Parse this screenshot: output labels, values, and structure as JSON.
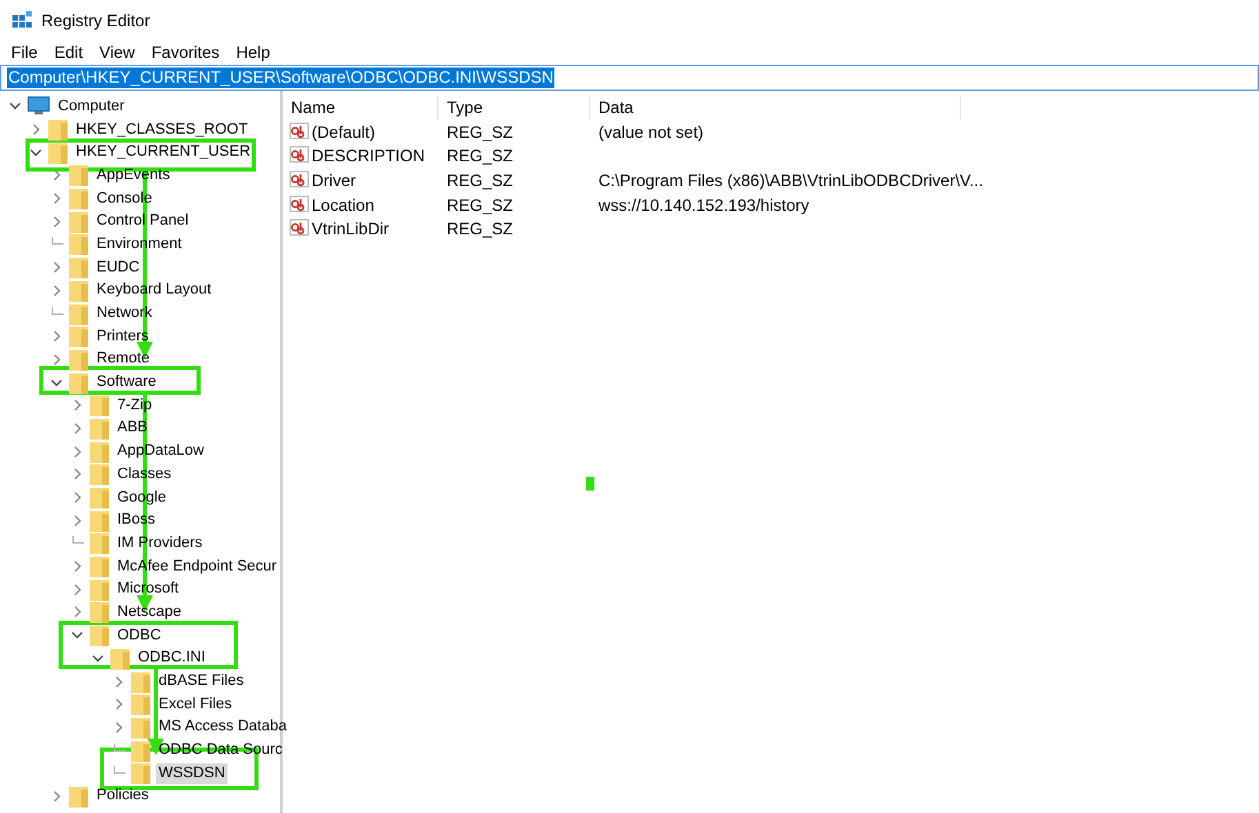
{
  "window": {
    "title": "Registry Editor"
  },
  "menu": [
    "File",
    "Edit",
    "View",
    "Favorites",
    "Help"
  ],
  "address_bar": {
    "value": "Computer\\HKEY_CURRENT_USER\\Software\\ODBC\\ODBC.INI\\WSSDSN",
    "highlighted": true
  },
  "tree": [
    {
      "label": "Computer",
      "kind": "computer",
      "expanded": true,
      "selected": false,
      "has_children": true,
      "children": [
        {
          "label": "HKEY_CLASSES_ROOT",
          "kind": "folder",
          "expanded": false,
          "selected": false,
          "has_children": true
        },
        {
          "label": "HKEY_CURRENT_USER",
          "kind": "folder",
          "expanded": true,
          "selected": false,
          "has_children": true,
          "children": [
            {
              "label": "AppEvents",
              "kind": "folder",
              "expanded": false,
              "selected": false,
              "has_children": true
            },
            {
              "label": "Console",
              "kind": "folder",
              "expanded": false,
              "selected": false,
              "has_children": true
            },
            {
              "label": "Control Panel",
              "kind": "folder",
              "expanded": false,
              "selected": false,
              "has_children": true
            },
            {
              "label": "Environment",
              "kind": "folder",
              "expanded": false,
              "selected": false,
              "has_children": false
            },
            {
              "label": "EUDC",
              "kind": "folder",
              "expanded": false,
              "selected": false,
              "has_children": true
            },
            {
              "label": "Keyboard Layout",
              "kind": "folder",
              "expanded": false,
              "selected": false,
              "has_children": true
            },
            {
              "label": "Network",
              "kind": "folder",
              "expanded": false,
              "selected": false,
              "has_children": false
            },
            {
              "label": "Printers",
              "kind": "folder",
              "expanded": false,
              "selected": false,
              "has_children": true
            },
            {
              "label": "Remote",
              "kind": "folder",
              "expanded": false,
              "selected": false,
              "has_children": true
            },
            {
              "label": "Software",
              "kind": "folder",
              "expanded": true,
              "selected": false,
              "has_children": true,
              "children": [
                {
                  "label": "7-Zip",
                  "kind": "folder",
                  "expanded": false,
                  "selected": false,
                  "has_children": true
                },
                {
                  "label": "ABB",
                  "kind": "folder",
                  "expanded": false,
                  "selected": false,
                  "has_children": true
                },
                {
                  "label": "AppDataLow",
                  "kind": "folder",
                  "expanded": false,
                  "selected": false,
                  "has_children": true
                },
                {
                  "label": "Classes",
                  "kind": "folder",
                  "expanded": false,
                  "selected": false,
                  "has_children": true
                },
                {
                  "label": "Google",
                  "kind": "folder",
                  "expanded": false,
                  "selected": false,
                  "has_children": true
                },
                {
                  "label": "IBoss",
                  "kind": "folder",
                  "expanded": false,
                  "selected": false,
                  "has_children": true
                },
                {
                  "label": "IM Providers",
                  "kind": "folder",
                  "expanded": false,
                  "selected": false,
                  "has_children": false
                },
                {
                  "label": "McAfee Endpoint Secur",
                  "kind": "folder",
                  "expanded": false,
                  "selected": false,
                  "has_children": true
                },
                {
                  "label": "Microsoft",
                  "kind": "folder",
                  "expanded": false,
                  "selected": false,
                  "has_children": true
                },
                {
                  "label": "Netscape",
                  "kind": "folder",
                  "expanded": false,
                  "selected": false,
                  "has_children": true
                },
                {
                  "label": "ODBC",
                  "kind": "folder",
                  "expanded": true,
                  "selected": false,
                  "has_children": true,
                  "children": [
                    {
                      "label": "ODBC.INI",
                      "kind": "folder",
                      "expanded": true,
                      "selected": false,
                      "has_children": true,
                      "children": [
                        {
                          "label": "dBASE Files",
                          "kind": "folder",
                          "expanded": false,
                          "selected": false,
                          "has_children": true
                        },
                        {
                          "label": "Excel Files",
                          "kind": "folder",
                          "expanded": false,
                          "selected": false,
                          "has_children": true
                        },
                        {
                          "label": "MS Access Databa",
                          "kind": "folder",
                          "expanded": false,
                          "selected": false,
                          "has_children": true
                        },
                        {
                          "label": "ODBC Data Sourc",
                          "kind": "folder",
                          "expanded": false,
                          "selected": false,
                          "has_children": false
                        },
                        {
                          "label": "WSSDSN",
                          "kind": "folder",
                          "expanded": false,
                          "selected": true,
                          "has_children": false
                        }
                      ]
                    }
                  ]
                }
              ]
            },
            {
              "label": "Policies",
              "kind": "folder",
              "expanded": false,
              "selected": false,
              "has_children": true
            }
          ]
        }
      ]
    }
  ],
  "values_table": {
    "columns": [
      "Name",
      "Type",
      "Data"
    ],
    "rows": [
      {
        "name": "(Default)",
        "type": "REG_SZ",
        "data": "(value not set)"
      },
      {
        "name": "DESCRIPTION",
        "type": "REG_SZ",
        "data": ""
      },
      {
        "name": "Driver",
        "type": "REG_SZ",
        "data": "C:\\Program Files (x86)\\ABB\\VtrinLibODBCDriver\\V..."
      },
      {
        "name": "Location",
        "type": "REG_SZ",
        "data": "wss://10.140.152.193/history"
      },
      {
        "name": "VtrinLibDir",
        "type": "REG_SZ",
        "data": ""
      }
    ]
  }
}
